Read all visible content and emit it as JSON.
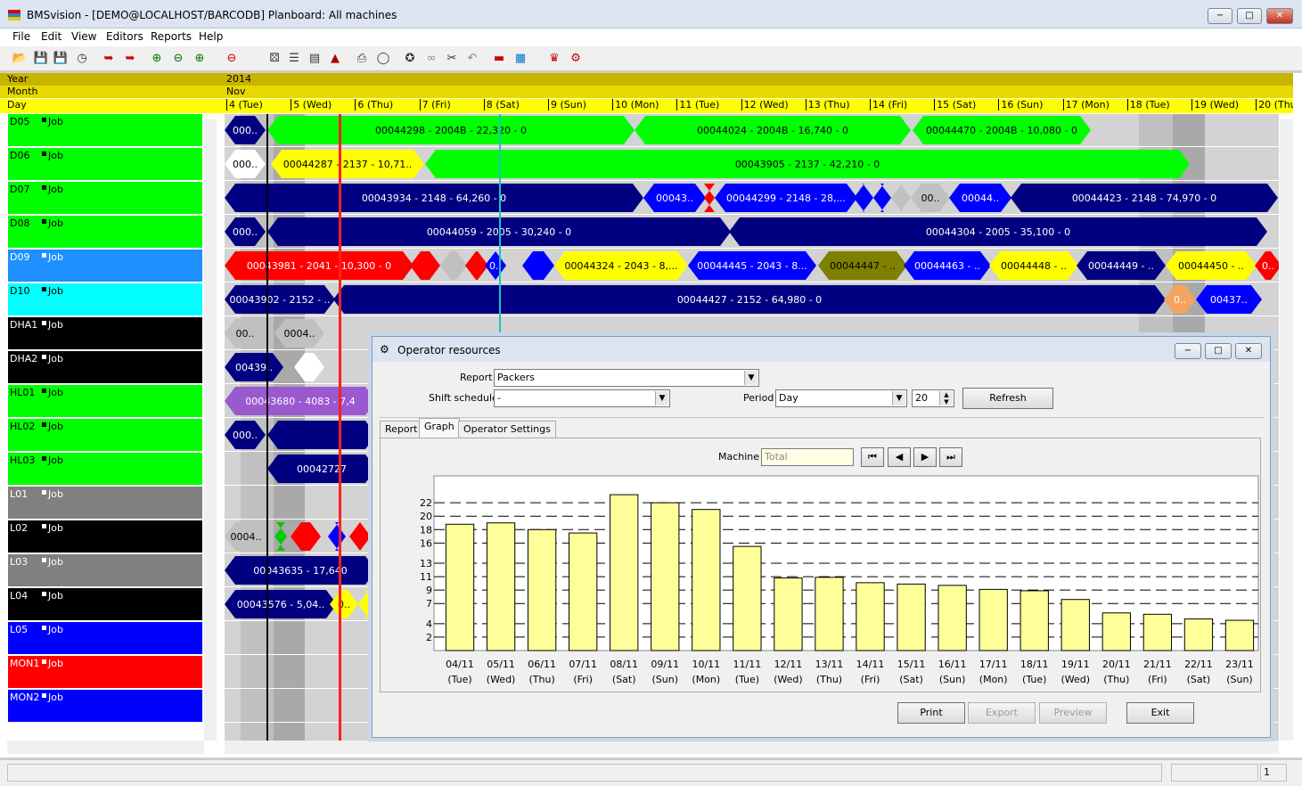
{
  "window": {
    "title": "BMSvision - [DEMO@LOCALHOST/BARCODB] Planboard: All machines",
    "minimize": "−",
    "maximize": "□",
    "close": "✕"
  },
  "menu": [
    "File",
    "Edit",
    "View",
    "Editors",
    "Reports",
    "Help"
  ],
  "toolbar_icons": [
    "open-icon",
    "save-icon",
    "save-all-icon",
    "clock-icon",
    "export-icon",
    "import-icon",
    "zoom-in-icon",
    "zoom-out-icon",
    "zoom-fit-icon",
    "zoom-dropdown-icon",
    "find-icon",
    "list-icon",
    "report-icon",
    "stamp-icon",
    "print-icon",
    "preview-icon",
    "split-icon",
    "link-icon",
    "cut-icon",
    "undo-icon",
    "color-bar-icon",
    "color-palette-icon",
    "resource-icon",
    "settings-icon"
  ],
  "timeline": {
    "year_label": "Year",
    "month_label": "Month",
    "day_label": "Day",
    "year": "2014",
    "month": "Nov",
    "days": [
      "4 (Tue)",
      "5 (Wed)",
      "6 (Thu)",
      "7 (Fri)",
      "8 (Sat)",
      "9 (Sun)",
      "10 (Mon)",
      "11 (Tue)",
      "12 (Wed)",
      "13 (Thu)",
      "14 (Fri)",
      "15 (Sat)",
      "16 (Sun)",
      "17 (Mon)",
      "18 (Tue)",
      "19 (Wed)",
      "20 (Thu)"
    ]
  },
  "machines": [
    {
      "name": "D05",
      "job": "Job",
      "color": "#00ff00",
      "text": "#000000"
    },
    {
      "name": "D06",
      "job": "Job",
      "color": "#00ff00",
      "text": "#000000"
    },
    {
      "name": "D07",
      "job": "Job",
      "color": "#00ff00",
      "text": "#000000"
    },
    {
      "name": "D08",
      "job": "Job",
      "color": "#00ff00",
      "text": "#000000"
    },
    {
      "name": "D09",
      "job": "Job",
      "color": "#1e90ff",
      "text": "#ffffff"
    },
    {
      "name": "D10",
      "job": "Job",
      "color": "#00ffff",
      "text": "#000000"
    },
    {
      "name": "DHA1",
      "job": "Job",
      "color": "#000000",
      "text": "#ffffff"
    },
    {
      "name": "DHA2",
      "job": "Job",
      "color": "#000000",
      "text": "#ffffff"
    },
    {
      "name": "HL01",
      "job": "Job",
      "color": "#00ff00",
      "text": "#000000"
    },
    {
      "name": "HL02",
      "job": "Job",
      "color": "#00ff00",
      "text": "#000000"
    },
    {
      "name": "HL03",
      "job": "Job",
      "color": "#00ff00",
      "text": "#000000"
    },
    {
      "name": "L01",
      "job": "Job",
      "color": "#808080",
      "text": "#ffffff"
    },
    {
      "name": "L02",
      "job": "Job",
      "color": "#000000",
      "text": "#ffffff"
    },
    {
      "name": "L03",
      "job": "Job",
      "color": "#808080",
      "text": "#ffffff"
    },
    {
      "name": "L04",
      "job": "Job",
      "color": "#000000",
      "text": "#ffffff"
    },
    {
      "name": "L05",
      "job": "Job",
      "color": "#0000ff",
      "text": "#ffffff"
    },
    {
      "name": "MON1",
      "job": "Job",
      "color": "#ff0000",
      "text": "#ffffff"
    },
    {
      "name": "MON2",
      "job": "Job",
      "color": "#0000ff",
      "text": "#ffffff"
    }
  ],
  "gantt_rows": [
    [
      {
        "label": "000..",
        "color": "#000080",
        "fg": "#ffffff"
      },
      {
        "label": "00044298 - 2004B - 22,320 - 0",
        "color": "#00ff00",
        "fg": "#000000"
      },
      {
        "label": "00044024 - 2004B - 16,740 - 0",
        "color": "#00ff00",
        "fg": "#000000"
      },
      {
        "label": "00044470 - 2004B - 10,080 - 0",
        "color": "#00ff00",
        "fg": "#000000"
      }
    ],
    [
      {
        "label": "000..",
        "color": "#ffffff",
        "fg": "#000000"
      },
      {
        "label": "00044287 - 2137 - 10,71..",
        "color": "#ffff00",
        "fg": "#000000"
      },
      {
        "label": "00043905 - 2137 - 42,210 - 0",
        "color": "#00ff00",
        "fg": "#000000"
      }
    ],
    [
      {
        "label": "00043934 - 2148 - 64,260 - 0",
        "color": "#000080",
        "fg": "#ffffff"
      },
      {
        "label": "00043..",
        "color": "#0000ff",
        "fg": "#ffffff"
      },
      {
        "label": "",
        "color": "#ff0000",
        "fg": "#ffffff"
      },
      {
        "label": "00044299 - 2148 - 28,...",
        "color": "#0000ff",
        "fg": "#ffffff"
      },
      {
        "label": "",
        "color": "#0000ff",
        "fg": "#ffffff"
      },
      {
        "label": "",
        "color": "#0000ff",
        "fg": "#ffffff"
      },
      {
        "label": "",
        "color": "#c0c0c0",
        "fg": "#000000"
      },
      {
        "label": "00..",
        "color": "#c0c0c0",
        "fg": "#000000"
      },
      {
        "label": "00044..",
        "color": "#0000ff",
        "fg": "#ffffff"
      },
      {
        "label": "00044423 - 2148 - 74,970 - 0",
        "color": "#000080",
        "fg": "#ffffff"
      }
    ],
    [
      {
        "label": "000..",
        "color": "#000080",
        "fg": "#ffffff"
      },
      {
        "label": "00044059 - 2005 - 30,240 - 0",
        "color": "#000080",
        "fg": "#ffffff"
      },
      {
        "label": "00044304 - 2005 - 35,100 - 0",
        "color": "#000080",
        "fg": "#ffffff"
      }
    ],
    [
      {
        "label": "00043981 - 2041 - 10,300 - 0",
        "color": "#ff0000",
        "fg": "#ffffff"
      },
      {
        "label": "",
        "color": "#ff0000",
        "fg": "#ffffff"
      },
      {
        "label": "",
        "color": "#c0c0c0",
        "fg": "#000000"
      },
      {
        "label": "",
        "color": "#ff0000",
        "fg": "#ffffff"
      },
      {
        "label": "0..",
        "color": "#0000ff",
        "fg": "#ffffff"
      },
      {
        "label": "",
        "color": "#0000ff",
        "fg": "#ffffff"
      },
      {
        "label": "00044324 - 2043 - 8,...",
        "color": "#ffff00",
        "fg": "#000000"
      },
      {
        "label": "00044445 - 2043 - 8...",
        "color": "#0000ff",
        "fg": "#ffffff"
      },
      {
        "label": "00044447 - ..",
        "color": "#808000",
        "fg": "#000000"
      },
      {
        "label": "00044463 - ..",
        "color": "#0000ff",
        "fg": "#ffffff"
      },
      {
        "label": "00044448 - ..",
        "color": "#ffff00",
        "fg": "#000000"
      },
      {
        "label": "00044449 - ..",
        "color": "#000080",
        "fg": "#ffffff"
      },
      {
        "label": "00044450 - ..",
        "color": "#ffff00",
        "fg": "#000000"
      },
      {
        "label": "0..",
        "color": "#ff0000",
        "fg": "#ffffff"
      }
    ],
    [
      {
        "label": "00043902 - 2152 - ..",
        "color": "#000080",
        "fg": "#ffffff"
      },
      {
        "label": "00044427 - 2152 - 64,980 - 0",
        "color": "#000080",
        "fg": "#ffffff"
      },
      {
        "label": "0..",
        "color": "#f4a460",
        "fg": "#ffffff"
      },
      {
        "label": "00437..",
        "color": "#0000ff",
        "fg": "#ffffff"
      }
    ],
    [
      {
        "label": "00..",
        "color": "#c0c0c0",
        "fg": "#000000"
      },
      {
        "label": "0004..",
        "color": "#c0c0c0",
        "fg": "#000000"
      }
    ],
    [
      {
        "label": "00439..",
        "color": "#000080",
        "fg": "#ffffff"
      },
      {
        "label": "",
        "color": "#ffffff",
        "fg": "#000000"
      }
    ],
    [
      {
        "label": "00043680 - 4083 - 7,4",
        "color": "#9b59d0",
        "fg": "#ffffff"
      }
    ],
    [
      {
        "label": "000..",
        "color": "#000080",
        "fg": "#ffffff"
      },
      {
        "label": "",
        "color": "#000080",
        "fg": "#ffffff"
      }
    ],
    [
      {
        "label": "00042727",
        "color": "#000080",
        "fg": "#ffffff"
      }
    ],
    [],
    [
      {
        "label": "0004..",
        "color": "#c0c0c0",
        "fg": "#000000"
      },
      {
        "label": "",
        "color": "#00cc00",
        "fg": "#000000"
      },
      {
        "label": "",
        "color": "#ff0000",
        "fg": "#ffffff"
      },
      {
        "label": "",
        "color": "#0000ff",
        "fg": "#ffffff"
      },
      {
        "label": "",
        "color": "#ff0000",
        "fg": "#ffffff"
      }
    ],
    [
      {
        "label": "00043635 - 17,640",
        "color": "#000080",
        "fg": "#ffffff"
      }
    ],
    [
      {
        "label": "00043576 - 5,04..",
        "color": "#000080",
        "fg": "#ffffff"
      },
      {
        "label": "0..",
        "color": "#ffff00",
        "fg": "#000000"
      },
      {
        "label": "",
        "color": "#ffff00",
        "fg": "#000000"
      }
    ],
    [],
    [],
    []
  ],
  "dialog": {
    "title": "Operator resources",
    "report_label": "Report",
    "report_value": "Packers",
    "shift_label": "Shift schedule",
    "shift_value": "-",
    "period_label": "Period",
    "period_value": "Day",
    "period_count": "20",
    "refresh": "Refresh",
    "tabs": [
      "Report",
      "Graph",
      "Operator Settings"
    ],
    "active_tab": "Graph",
    "machine_label": "Machine",
    "machine_value": "Total",
    "nav_buttons": [
      "first-icon",
      "prev-icon",
      "next-icon",
      "last-icon"
    ],
    "print": "Print",
    "export": "Export",
    "preview": "Preview",
    "exit": "Exit"
  },
  "chart_data": {
    "type": "bar",
    "title": "",
    "xlabel": "",
    "ylabel": "",
    "yticks": [
      2,
      4,
      7,
      9,
      11,
      13,
      16,
      18,
      20,
      22
    ],
    "ylim": [
      0,
      26
    ],
    "grid": true,
    "bar_color": "#ffff99",
    "categories": [
      "04/11 (Tue)",
      "05/11 (Wed)",
      "06/11 (Thu)",
      "07/11 (Fri)",
      "08/11 (Sat)",
      "09/11 (Sun)",
      "10/11 (Mon)",
      "11/11 (Tue)",
      "12/11 (Wed)",
      "13/11 (Thu)",
      "14/11 (Fri)",
      "15/11 (Sat)",
      "16/11 (Sun)",
      "17/11 (Mon)",
      "18/11 (Tue)",
      "19/11 (Wed)",
      "20/11 (Thu)",
      "21/11 (Fri)",
      "22/11 (Sat)",
      "23/11 (Sun)"
    ],
    "category_dates": [
      "04/11",
      "05/11",
      "06/11",
      "07/11",
      "08/11",
      "09/11",
      "10/11",
      "11/11",
      "12/11",
      "13/11",
      "14/11",
      "15/11",
      "16/11",
      "17/11",
      "18/11",
      "19/11",
      "20/11",
      "21/11",
      "22/11",
      "23/11"
    ],
    "category_days": [
      "(Tue)",
      "(Wed)",
      "(Thu)",
      "(Fri)",
      "(Sat)",
      "(Sun)",
      "(Mon)",
      "(Tue)",
      "(Wed)",
      "(Thu)",
      "(Fri)",
      "(Sat)",
      "(Sun)",
      "(Mon)",
      "(Tue)",
      "(Wed)",
      "(Thu)",
      "(Fri)",
      "(Sat)",
      "(Sun)"
    ],
    "values": [
      18.8,
      19.0,
      18.0,
      17.5,
      23.2,
      22.0,
      21.0,
      15.5,
      10.8,
      10.9,
      10.1,
      9.9,
      9.7,
      9.1,
      8.9,
      7.6,
      5.6,
      5.4,
      4.7,
      4.5
    ]
  },
  "status": {
    "page": "1"
  }
}
